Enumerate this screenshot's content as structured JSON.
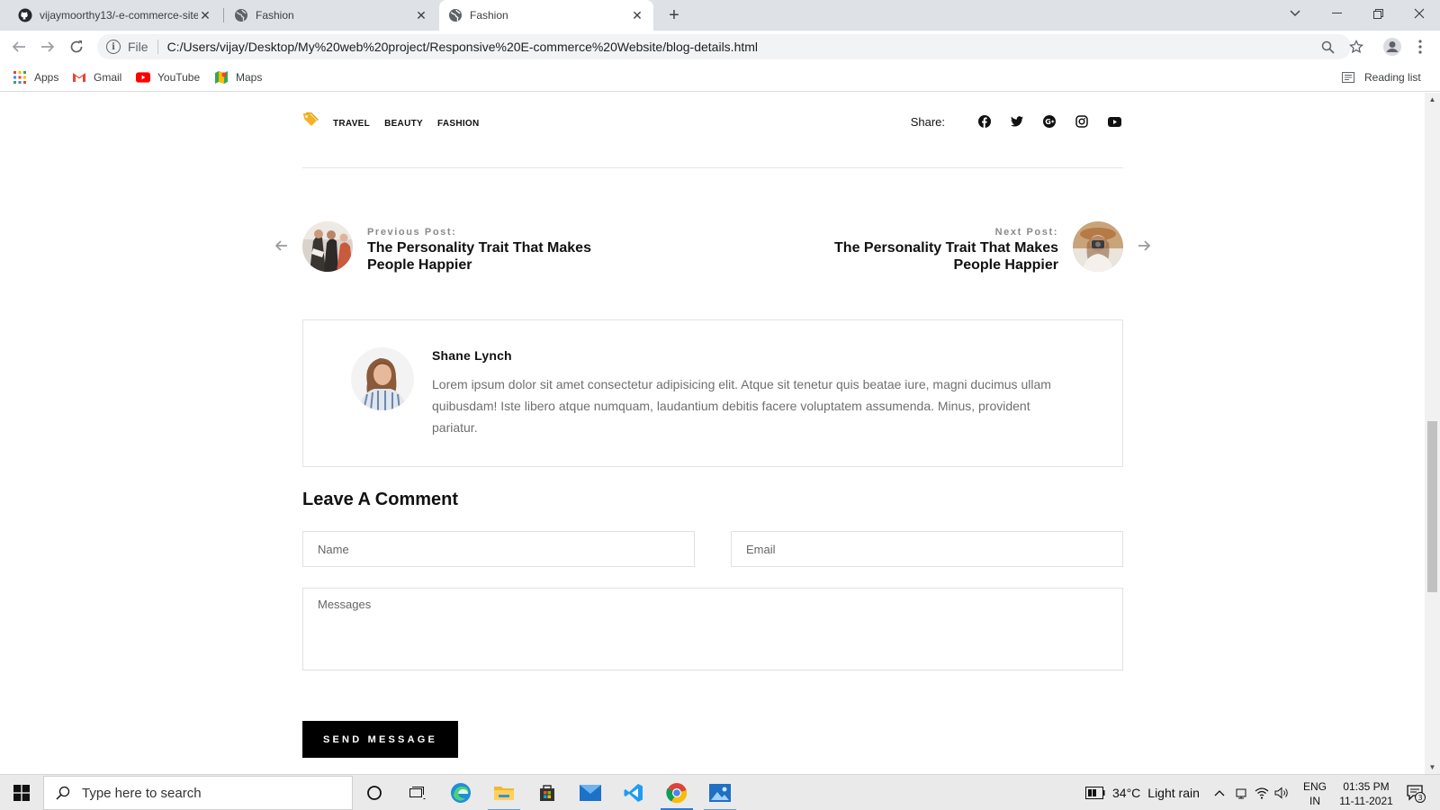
{
  "browser": {
    "tabs": [
      {
        "title": "vijaymoorthy13/-e-commerce-site",
        "icon": "github-icon",
        "active": false
      },
      {
        "title": "Fashion",
        "icon": "globe-icon",
        "active": false
      },
      {
        "title": "Fashion",
        "icon": "globe-icon",
        "active": true
      }
    ],
    "address": {
      "protocol_label": "File",
      "url": "C:/Users/vijay/Desktop/My%20web%20project/Responsive%20E-commerce%20Website/blog-details.html"
    },
    "bookmarks": [
      {
        "label": "Apps",
        "icon": "apps-grid-icon"
      },
      {
        "label": "Gmail",
        "icon": "gmail-icon"
      },
      {
        "label": "YouTube",
        "icon": "youtube-icon"
      },
      {
        "label": "Maps",
        "icon": "maps-icon"
      }
    ],
    "reading_list": "Reading list"
  },
  "page": {
    "tags": [
      "TRAVEL",
      "BEAUTY",
      "FASHION"
    ],
    "share_label": "Share:",
    "share_icons": [
      "facebook-icon",
      "twitter-icon",
      "google-plus-icon",
      "instagram-icon",
      "youtube-icon"
    ],
    "previous_post": {
      "label": "Previous Post:",
      "title": "The Personality Trait That Makes People Happier"
    },
    "next_post": {
      "label": "Next Post:",
      "title": "The Personality Trait That Makes People Happier"
    },
    "author": {
      "name": "Shane Lynch",
      "bio": "Lorem ipsum dolor sit amet consectetur adipisicing elit. Atque sit tenetur quis beatae iure, magni ducimus ullam quibusdam! Iste libero atque numquam, laudantium debitis facere voluptatem assumenda. Minus, provident pariatur."
    },
    "comment": {
      "title": "Leave A Comment",
      "name_placeholder": "Name",
      "email_placeholder": "Email",
      "message_placeholder": "Messages",
      "submit_label": "SEND MESSAGE"
    }
  },
  "taskbar": {
    "search_placeholder": "Type here to search",
    "weather_temp": "34°C",
    "weather_text": "Light rain",
    "lang_top": "ENG",
    "lang_bottom": "IN",
    "time": "01:35 PM",
    "date": "11-11-2021",
    "notification_count": "3"
  },
  "colors": {
    "tag_icon": "#f5b324",
    "button_bg": "#000000",
    "accent_blue": "#2b7bd6"
  }
}
